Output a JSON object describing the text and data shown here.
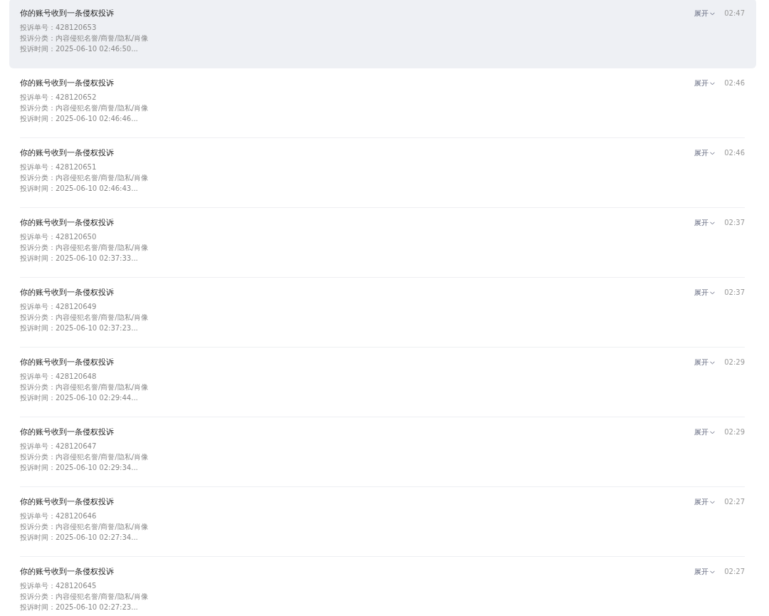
{
  "notifications": [
    {
      "title": "你的账号收到一条侵权投诉",
      "details": [
        "投诉单号：428120653",
        "投诉分类：内容侵犯名誉/商誉/隐私/肖像",
        "投诉时间：2025-06-10 02:46:50..."
      ],
      "expand": "展开",
      "time": "02:47",
      "highlighted": true
    },
    {
      "title": "你的账号收到一条侵权投诉",
      "details": [
        "投诉单号：428120652",
        "投诉分类：内容侵犯名誉/商誉/隐私/肖像",
        "投诉时间：2025-06-10 02:46:46..."
      ],
      "expand": "展开",
      "time": "02:46",
      "highlighted": false
    },
    {
      "title": "你的账号收到一条侵权投诉",
      "details": [
        "投诉单号：428120651",
        "投诉分类：内容侵犯名誉/商誉/隐私/肖像",
        "投诉时间：2025-06-10 02:46:43..."
      ],
      "expand": "展开",
      "time": "02:46",
      "highlighted": false
    },
    {
      "title": "你的账号收到一条侵权投诉",
      "details": [
        "投诉单号：428120650",
        "投诉分类：内容侵犯名誉/商誉/隐私/肖像",
        "投诉时间：2025-06-10 02:37:33..."
      ],
      "expand": "展开",
      "time": "02:37",
      "highlighted": false
    },
    {
      "title": "你的账号收到一条侵权投诉",
      "details": [
        "投诉单号：428120649",
        "投诉分类：内容侵犯名誉/商誉/隐私/肖像",
        "投诉时间：2025-06-10 02:37:23..."
      ],
      "expand": "展开",
      "time": "02:37",
      "highlighted": false
    },
    {
      "title": "你的账号收到一条侵权投诉",
      "details": [
        "投诉单号：428120648",
        "投诉分类：内容侵犯名誉/商誉/隐私/肖像",
        "投诉时间：2025-06-10 02:29:44..."
      ],
      "expand": "展开",
      "time": "02:29",
      "highlighted": false
    },
    {
      "title": "你的账号收到一条侵权投诉",
      "details": [
        "投诉单号：428120647",
        "投诉分类：内容侵犯名誉/商誉/隐私/肖像",
        "投诉时间：2025-06-10 02:29:34..."
      ],
      "expand": "展开",
      "time": "02:29",
      "highlighted": false
    },
    {
      "title": "你的账号收到一条侵权投诉",
      "details": [
        "投诉单号：428120646",
        "投诉分类：内容侵犯名誉/商誉/隐私/肖像",
        "投诉时间：2025-06-10 02:27:34..."
      ],
      "expand": "展开",
      "time": "02:27",
      "highlighted": false
    },
    {
      "title": "你的账号收到一条侵权投诉",
      "details": [
        "投诉单号：428120645",
        "投诉分类：内容侵犯名誉/商誉/隐私/肖像",
        "投诉时间：2025-06-10 02:27:23..."
      ],
      "expand": "展开",
      "time": "02:27",
      "highlighted": false
    }
  ]
}
